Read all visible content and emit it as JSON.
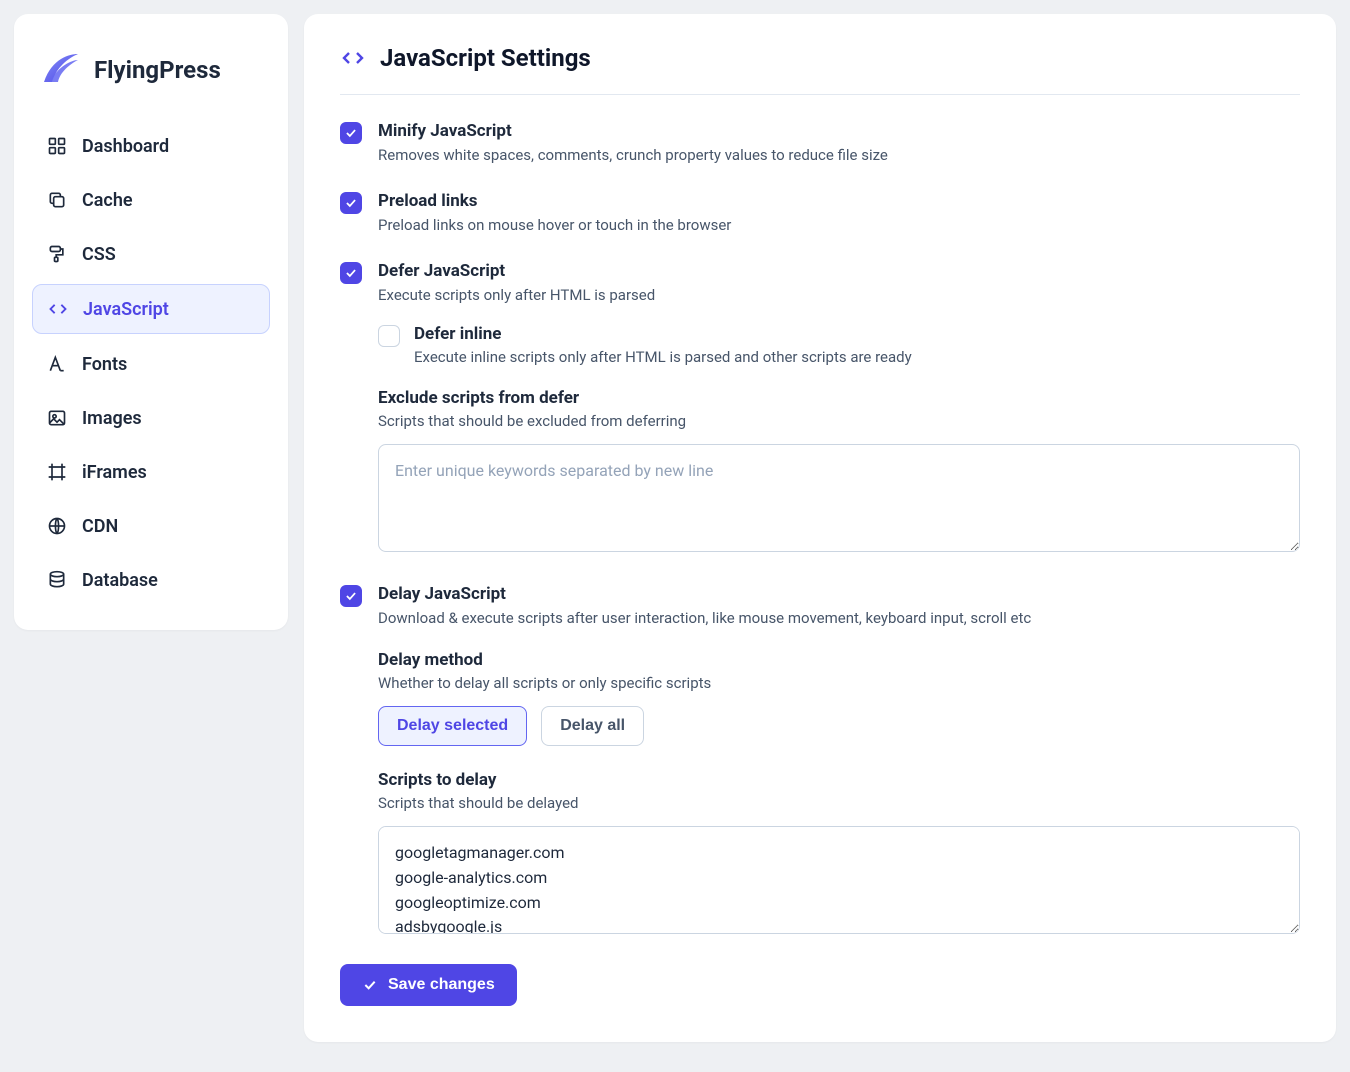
{
  "brand": {
    "name": "FlyingPress"
  },
  "sidebar": {
    "items": [
      {
        "label": "Dashboard",
        "icon": "dashboard-icon",
        "active": false
      },
      {
        "label": "Cache",
        "icon": "copy-icon",
        "active": false
      },
      {
        "label": "CSS",
        "icon": "paint-roller-icon",
        "active": false
      },
      {
        "label": "JavaScript",
        "icon": "code-icon",
        "active": true
      },
      {
        "label": "Fonts",
        "icon": "font-icon",
        "active": false
      },
      {
        "label": "Images",
        "icon": "image-icon",
        "active": false
      },
      {
        "label": "iFrames",
        "icon": "frame-icon",
        "active": false
      },
      {
        "label": "CDN",
        "icon": "globe-icon",
        "active": false
      },
      {
        "label": "Database",
        "icon": "database-icon",
        "active": false
      }
    ]
  },
  "page": {
    "title": "JavaScript Settings"
  },
  "settings": {
    "minify": {
      "checked": true,
      "title": "Minify JavaScript",
      "desc": "Removes white spaces, comments, crunch property values to reduce file size"
    },
    "preload": {
      "checked": true,
      "title": "Preload links",
      "desc": "Preload links on mouse hover or touch in the browser"
    },
    "defer": {
      "checked": true,
      "title": "Defer JavaScript",
      "desc": "Execute scripts only after HTML is parsed",
      "inline": {
        "checked": false,
        "title": "Defer inline",
        "desc": "Execute inline scripts only after HTML is parsed and other scripts are ready"
      },
      "exclude": {
        "title": "Exclude scripts from defer",
        "desc": "Scripts that should be excluded from deferring",
        "placeholder": "Enter unique keywords separated by new line",
        "value": ""
      }
    },
    "delay": {
      "checked": true,
      "title": "Delay JavaScript",
      "desc": "Download & execute scripts after user interaction, like mouse movement, keyboard input, scroll etc",
      "method": {
        "title": "Delay method",
        "desc": "Whether to delay all scripts or only specific scripts",
        "options": {
          "selected": "Delay selected",
          "all": "Delay all"
        },
        "active": "selected"
      },
      "scripts": {
        "title": "Scripts to delay",
        "desc": "Scripts that should be delayed",
        "value": "googletagmanager.com\ngoogle-analytics.com\ngoogleoptimize.com\nadsbygoogle.js"
      }
    }
  },
  "actions": {
    "save": "Save changes"
  }
}
